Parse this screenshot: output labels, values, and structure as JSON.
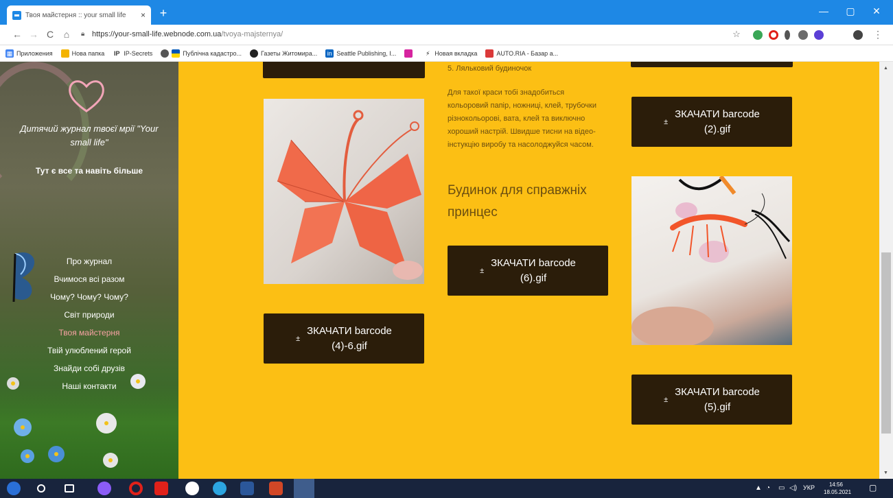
{
  "browser": {
    "tab_title": "Твоя майстерня :: your small life",
    "tab_close": "×",
    "new_tab": "+",
    "window_controls": {
      "minimize": "—",
      "maximize": "▢",
      "close": "✕"
    },
    "url_host": "https://your-small-life.webnode.com.ua",
    "url_path": "/tvoya-majsternya/",
    "nav": {
      "back": "←",
      "forward": "→",
      "reload": "C",
      "home": "⌂"
    },
    "bookmarks": [
      {
        "label": "Приложения",
        "icon": "apps-grid-icon",
        "color": "#4285f4"
      },
      {
        "label": "Нова папка",
        "icon": "folder-icon",
        "color": "#f4b400"
      },
      {
        "label": "IP-Secrets",
        "icon": "ip-icon",
        "color": "#333333"
      },
      {
        "label": "Публічна кадастро...",
        "icon": "flag-icon",
        "color": "#0057b7"
      },
      {
        "label": "Газеты Житомира...",
        "icon": "newspaper-icon",
        "color": "#222222"
      },
      {
        "label": "Seattle Publishing, I...",
        "icon": "linkedin-icon",
        "color": "#0a66c2"
      },
      {
        "label": "",
        "icon": "instagram-icon",
        "color": "#d6249f"
      },
      {
        "label": "Новая вкладка",
        "icon": "bolt-icon",
        "color": "#333333"
      },
      {
        "label": "AUTO.RIA - Базар а...",
        "icon": "auto-icon",
        "color": "#db3a3a"
      }
    ]
  },
  "sidebar": {
    "title": "Дитячий журнал твоєї мрії \"Your small life\"",
    "subtitle": "Тут є все та навіть більше",
    "menu": [
      {
        "label": "Про журнал",
        "active": false
      },
      {
        "label": "Вчимося всі разом",
        "active": false
      },
      {
        "label": "Чому? Чому? Чому?",
        "active": false
      },
      {
        "label": "Світ природи",
        "active": false
      },
      {
        "label": "Твоя майстерня",
        "active": true
      },
      {
        "label": "Твій улюблений герой",
        "active": false
      },
      {
        "label": "Знайди собі друзів",
        "active": false
      },
      {
        "label": "Наші контакти",
        "active": false
      }
    ]
  },
  "content": {
    "item_title": "5. Ляльковий будиночок",
    "description": "Для такої краси тобі знадобиться кольоровий папір, ножниці, клей, трубочки різнокольорові, вата, клей та виключно хороший настрій. Швидше тисни на відео-інстукцію виробу та насолоджуйся часом.",
    "heading": "Будинок для справжніх принцес",
    "download_icon": "±",
    "buttons": {
      "b1_line1": "ЗКАЧАТИ barcode",
      "b1_line2": "(4)-6.gif",
      "b2_line1": "ЗКАЧАТИ barcode",
      "b2_line2": "(6).gif",
      "b3_line1": "ЗКАЧАТИ barcode",
      "b3_line2": "(2).gif",
      "b4_line1": "ЗКАЧАТИ barcode",
      "b4_line2": "(5).gif"
    }
  },
  "taskbar": {
    "language": "УКР",
    "time": "14:56",
    "date": "18.05.2021"
  },
  "colors": {
    "page_background": "#fcbf14",
    "button": "#2b1d0a",
    "active_menu": "#f7a3a3",
    "title_bar": "#1e88e5"
  }
}
